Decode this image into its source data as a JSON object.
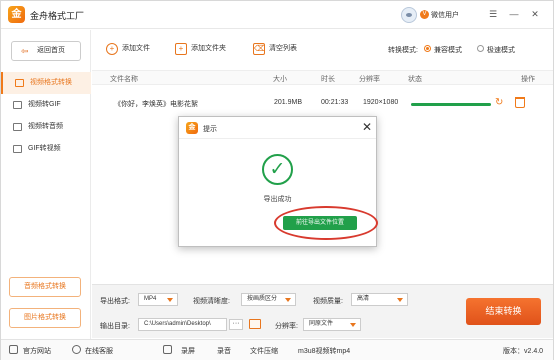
{
  "window": {
    "title": "金舟格式工厂",
    "logo_glyph": "金",
    "user_name": "微信用户",
    "vip_glyph": "V",
    "controls": [
      "☰",
      "—",
      "✕"
    ]
  },
  "sidebar": {
    "back_label": "返回首页",
    "items": [
      {
        "label": "视频格式转换",
        "active": true
      },
      {
        "label": "视频转GIF",
        "active": false
      },
      {
        "label": "视频转音频",
        "active": false
      },
      {
        "label": "GIF转视频",
        "active": false
      }
    ],
    "audio_btn": "音频格式转换",
    "image_btn": "图片格式转换"
  },
  "toolbar": {
    "add_file": "添加文件",
    "add_folder": "添加文件夹",
    "clear_list": "清空列表",
    "mode_label": "转换模式:",
    "mode_compat": "兼容模式",
    "mode_fast": "极速模式",
    "selected_mode": "兼容模式"
  },
  "table": {
    "headers": {
      "name": "文件名称",
      "size": "大小",
      "duration": "时长",
      "resolution": "分辨率",
      "status": "状态",
      "action": "操作"
    },
    "rows": [
      {
        "name": "《你好，李焕英》电影花絮",
        "size": "201.9MB",
        "duration": "00:21:33",
        "resolution": "1920×1080",
        "progress": 1.0
      }
    ]
  },
  "dialog": {
    "title": "提示",
    "message": "导出成功",
    "open_folder_btn": "前往导出文件位置",
    "success_glyph": "✓",
    "close_glyph": "✕"
  },
  "settings": {
    "format_label": "导出格式:",
    "format_value": "MP4",
    "clarity_label": "视频清晰度:",
    "clarity_value": "按画质区分",
    "quality_label": "视频质量:",
    "quality_value": "高清",
    "output_label": "输出目录:",
    "output_path": "C:\\Users\\admin\\Desktop\\",
    "dots_label": "···",
    "resolution_label": "分辨率:",
    "resolution_value": "同原文件",
    "finish_btn": "结束转换"
  },
  "footer": {
    "website": "官方网站",
    "support": "在线客服",
    "record": "录屏",
    "audio_rec": "录音",
    "pdf": "文件压缩",
    "m3u8": "m3u8视频转mp4",
    "version": "版本：v2.4.0"
  },
  "colors": {
    "accent": "#f07a1a",
    "success": "#21a04a",
    "highlight": "#d83a2e"
  }
}
